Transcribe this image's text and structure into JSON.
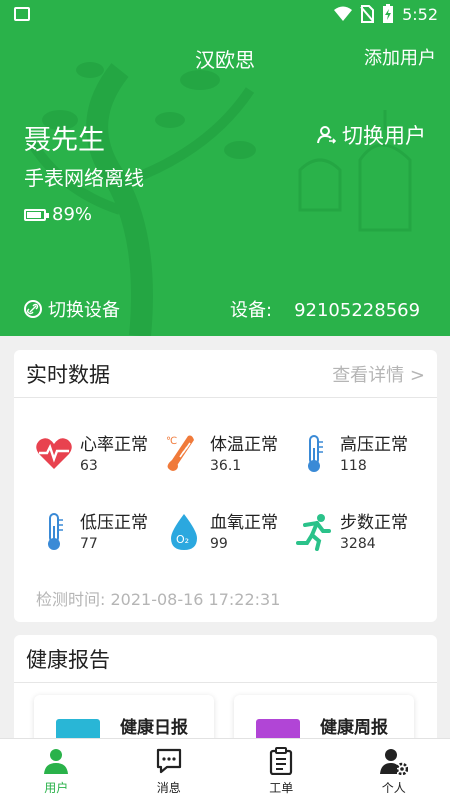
{
  "status_bar": {
    "time": "5:52"
  },
  "header": {
    "app_title": "汉欧思",
    "add_user": "添加用户",
    "user_name": "聂先生",
    "switch_user": "切换用户",
    "watch_status": "手表网络离线",
    "battery": "89%",
    "battery_level": 0.89,
    "switch_device": "切换设备",
    "device_label": "设备:",
    "device_id": "92105228569"
  },
  "realtime": {
    "title": "实时数据",
    "detail_link": "查看详情 >",
    "metrics": [
      {
        "name": "心率正常",
        "value": "63",
        "icon": "heart-rate-icon"
      },
      {
        "name": "体温正常",
        "value": "36.1",
        "icon": "thermometer-icon"
      },
      {
        "name": "高压正常",
        "value": "118",
        "icon": "pressure-thermometer-icon"
      },
      {
        "name": "低压正常",
        "value": "77",
        "icon": "pressure-thermometer-icon"
      },
      {
        "name": "血氧正常",
        "value": "99",
        "icon": "oxygen-drop-icon"
      },
      {
        "name": "步数正常",
        "value": "3284",
        "icon": "running-person-icon"
      }
    ],
    "check_time": "检测时间:  2021-08-16 17:22:31"
  },
  "health_report": {
    "title": "健康报告",
    "tiles": [
      {
        "label": "健康日报",
        "icon": "daily-report-icon",
        "color": "#29b6d6"
      },
      {
        "label": "健康周报",
        "icon": "weekly-report-icon",
        "color": "#b145d6"
      }
    ]
  },
  "nav": {
    "items": [
      {
        "label": "用户",
        "icon": "user-icon"
      },
      {
        "label": "消息",
        "icon": "message-icon"
      },
      {
        "label": "工单",
        "icon": "clipboard-icon"
      },
      {
        "label": "个人",
        "icon": "profile-settings-icon"
      }
    ]
  },
  "colors": {
    "brand_green": "#2ab24a",
    "heart_red": "#e8424f",
    "temp_orange": "#f07a3a",
    "blue": "#3a8ad6",
    "oxygen_blue": "#2ba8df",
    "run_green": "#2bc28a"
  }
}
